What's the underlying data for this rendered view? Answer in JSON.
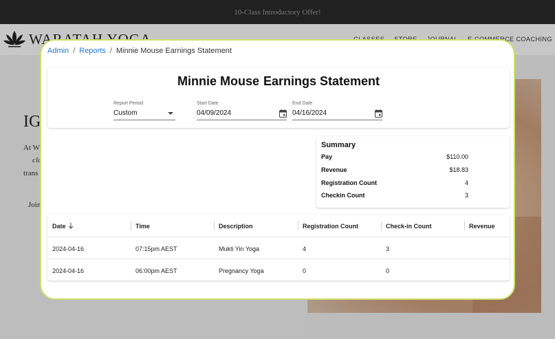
{
  "site": {
    "promo": "10-Class Introductory Offer!",
    "logo_text": "WARATAH YOGA",
    "nav": [
      "CLASSES",
      "STORE",
      "JOURNAL",
      "E-COMMERCE COACHING"
    ],
    "hero_heading": "IG",
    "hero_lines": [
      "At W",
      "cla",
      "trans",
      "Join"
    ]
  },
  "breadcrumb": {
    "items": [
      {
        "label": "Admin",
        "link": true
      },
      {
        "label": "Reports",
        "link": true
      },
      {
        "label": "Minnie Mouse Earnings Statement",
        "link": false
      }
    ],
    "separator": "/"
  },
  "report": {
    "name": "Minnie Mouse",
    "title": "Earnings Statement",
    "period_label": "Report Period",
    "period_value": "Custom",
    "start_label": "Start Date",
    "start_value": "04/09/2024",
    "end_label": "End Date",
    "end_value": "04/16/2024"
  },
  "summary": {
    "title": "Summary",
    "rows": [
      {
        "label": "Pay",
        "value": "$110.00"
      },
      {
        "label": "Revenue",
        "value": "$18.83"
      },
      {
        "label": "Registration Count",
        "value": "4"
      },
      {
        "label": "Checkin Count",
        "value": "3"
      }
    ]
  },
  "table": {
    "columns": [
      "Date",
      "Time",
      "Description",
      "Registration Count",
      "Check-in Count",
      "Revenue"
    ],
    "rows": [
      {
        "date": "2024-04-16",
        "time": "07:15pm AEST",
        "description": "Mukti Yin Yoga",
        "registrations": "4",
        "checkins": "3",
        "revenue": ""
      },
      {
        "date": "2024-04-16",
        "time": "06:00pm AEST",
        "description": "Pregnancy Yoga",
        "registrations": "0",
        "checkins": "0",
        "revenue": ""
      }
    ]
  },
  "colors": {
    "link": "#1f77d0",
    "modal_border": "#cfe06a",
    "topbar": "#2b2b2b"
  }
}
